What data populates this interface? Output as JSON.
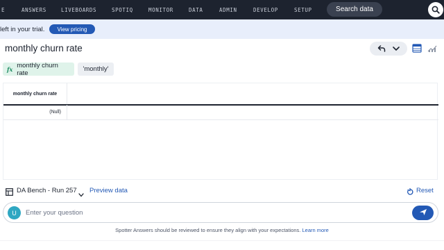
{
  "nav": {
    "items": [
      {
        "label": "E"
      },
      {
        "label": "ANSWERS"
      },
      {
        "label": "LIVEBOARDS"
      },
      {
        "label": "SPOTIQ"
      },
      {
        "label": "MONITOR"
      },
      {
        "label": "DATA"
      },
      {
        "label": "ADMIN"
      },
      {
        "label": "DEVELOP"
      },
      {
        "label": "SETUP"
      }
    ],
    "search_label": "Search data",
    "search_icon": "search-icon"
  },
  "trial": {
    "text": "left in your trial.",
    "button_label": "View pricing"
  },
  "answer": {
    "title": "monthly churn rate",
    "chips": [
      {
        "prefix": "fx",
        "label": "monthly churn rate"
      },
      {
        "label": "'monthly'"
      }
    ]
  },
  "table": {
    "columns": [
      "monthly churn rate"
    ],
    "rows": [
      [
        "(Null)"
      ]
    ]
  },
  "datasource": {
    "name": "DA Bench - Run 257",
    "preview_label": "Preview data",
    "reset_label": "Reset"
  },
  "question": {
    "avatar_initial": "U",
    "placeholder": "Enter your question"
  },
  "disclaimer": {
    "text": "Spotter Answers should be reviewed to ensure they align with your expectations.",
    "link": "Learn more"
  },
  "colors": {
    "nav_bg": "#1d232f",
    "accent": "#2359b5",
    "chip_formula": "#dff3ea",
    "avatar": "#2fa7c2"
  }
}
